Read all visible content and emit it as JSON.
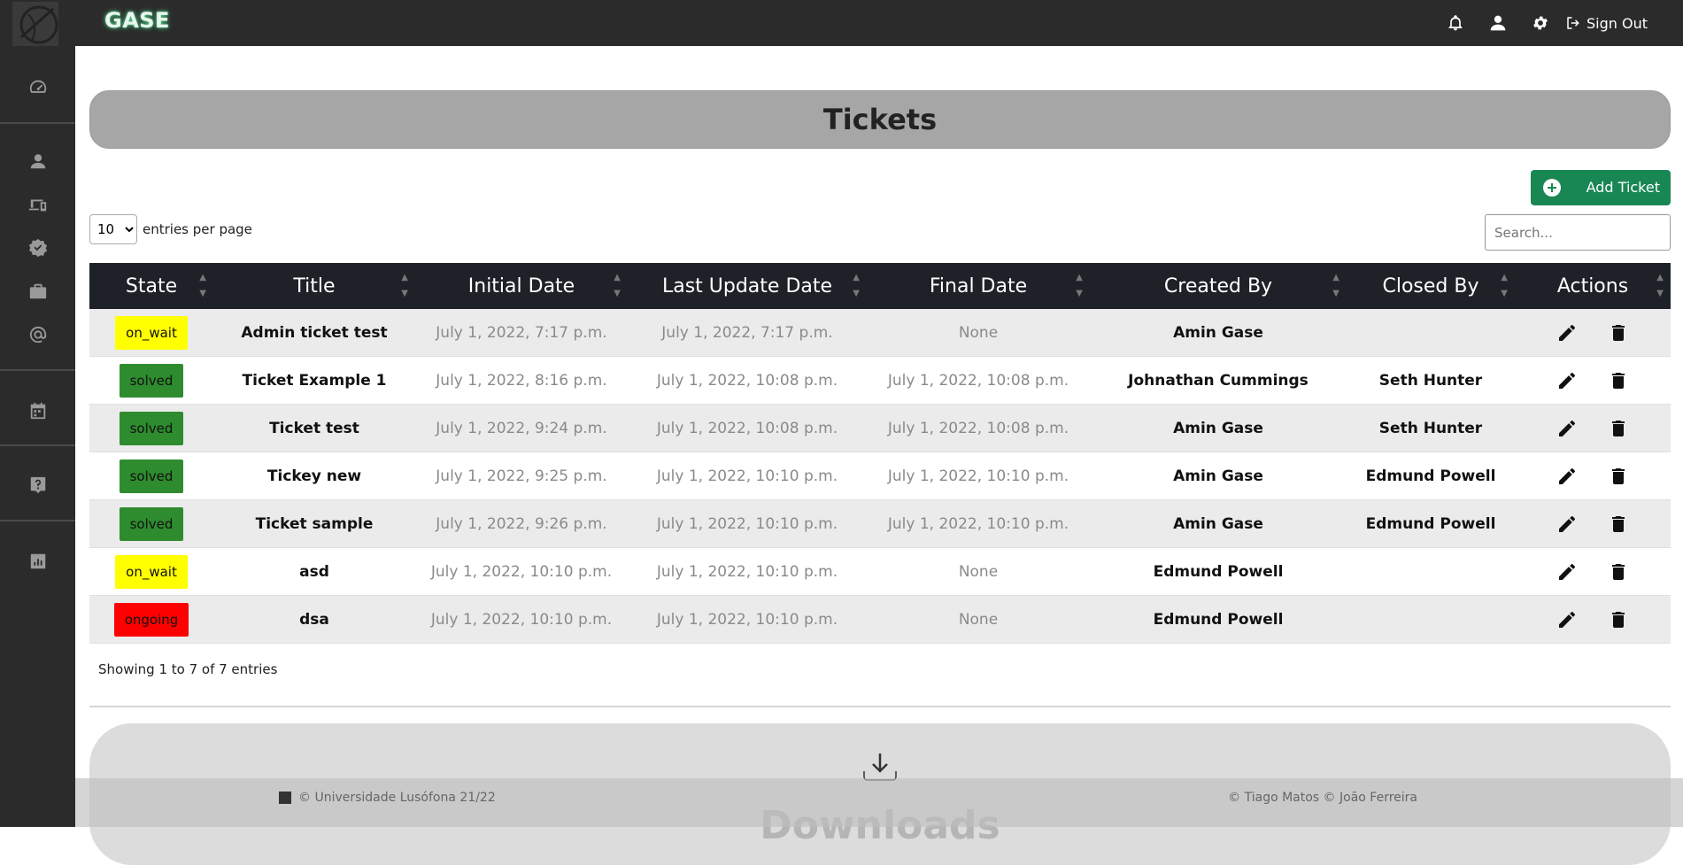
{
  "app": {
    "brand": "GASE"
  },
  "topbar": {
    "icons": [
      "bell-icon",
      "user-icon",
      "gear-icon"
    ],
    "signout_label": "Sign Out"
  },
  "sidebar": {
    "items": [
      "dashboard-gauge-icon",
      "user-icon",
      "devices-icon",
      "verified-badge-icon",
      "briefcase-icon",
      "at-sign-icon",
      "calendar-icon",
      "help-icon",
      "report-chart-icon"
    ]
  },
  "page": {
    "title": "Tickets"
  },
  "toolbar": {
    "add_label": "Add Ticket",
    "entries_value": "10",
    "entries_label": "entries per page",
    "search_placeholder": "Search..."
  },
  "table": {
    "headers": [
      "State",
      "Title",
      "Initial Date",
      "Last Update Date",
      "Final Date",
      "Created By",
      "Closed By",
      "Actions"
    ],
    "rows": [
      {
        "state": "on_wait",
        "title": "Admin ticket test",
        "initial": "July 1, 2022, 7:17 p.m.",
        "updated": "July 1, 2022, 7:17 p.m.",
        "final": "None",
        "created_by": "Amin Gase",
        "closed_by": ""
      },
      {
        "state": "solved",
        "title": "Ticket Example 1",
        "initial": "July 1, 2022, 8:16 p.m.",
        "updated": "July 1, 2022, 10:08 p.m.",
        "final": "July 1, 2022, 10:08 p.m.",
        "created_by": "Johnathan Cummings",
        "closed_by": "Seth Hunter"
      },
      {
        "state": "solved",
        "title": "Ticket test",
        "initial": "July 1, 2022, 9:24 p.m.",
        "updated": "July 1, 2022, 10:08 p.m.",
        "final": "July 1, 2022, 10:08 p.m.",
        "created_by": "Amin Gase",
        "closed_by": "Seth Hunter"
      },
      {
        "state": "solved",
        "title": "Tickey new",
        "initial": "July 1, 2022, 9:25 p.m.",
        "updated": "July 1, 2022, 10:10 p.m.",
        "final": "July 1, 2022, 10:10 p.m.",
        "created_by": "Amin Gase",
        "closed_by": "Edmund Powell"
      },
      {
        "state": "solved",
        "title": "Ticket sample",
        "initial": "July 1, 2022, 9:26 p.m.",
        "updated": "July 1, 2022, 10:10 p.m.",
        "final": "July 1, 2022, 10:10 p.m.",
        "created_by": "Amin Gase",
        "closed_by": "Edmund Powell"
      },
      {
        "state": "on_wait",
        "title": "asd",
        "initial": "July 1, 2022, 10:10 p.m.",
        "updated": "July 1, 2022, 10:10 p.m.",
        "final": "None",
        "created_by": "Edmund Powell",
        "closed_by": ""
      },
      {
        "state": "ongoing",
        "title": "dsa",
        "initial": "July 1, 2022, 10:10 p.m.",
        "updated": "July 1, 2022, 10:10 p.m.",
        "final": "None",
        "created_by": "Edmund Powell",
        "closed_by": ""
      }
    ],
    "state_colors": {
      "on_wait": "#ffff00",
      "solved": "#2e8b2e",
      "ongoing": "#ff0000"
    }
  },
  "pagination": {
    "summary": "Showing 1 to 7 of 7 entries"
  },
  "downloads": {
    "title": "Downloads"
  },
  "footer": {
    "left": "© Universidade Lusófona 21/22",
    "right": "© Tiago Matos © João Ferreira"
  },
  "colors": {
    "accent_green": "#198754",
    "topbar": "#2b2b2b",
    "header": "#1e2128"
  }
}
